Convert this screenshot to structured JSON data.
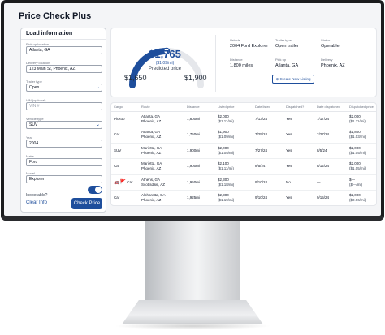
{
  "app": {
    "title": "Price Check Plus"
  },
  "form": {
    "heading": "Load information",
    "fields": [
      {
        "label": "Pick up location",
        "value": "Atlanta, GA"
      },
      {
        "label": "Delivery location",
        "value": "123 Main St, Phoenix, AZ"
      },
      {
        "label": "Trailer type",
        "value": "Open"
      },
      {
        "label": "VIN (optional)",
        "placeholder": "VIN #"
      },
      {
        "label": "Vehicle type",
        "value": "SUV"
      },
      {
        "label": "Year",
        "value": "2004"
      },
      {
        "label": "Make",
        "value": "Ford"
      },
      {
        "label": "Model",
        "value": "Explorer"
      }
    ],
    "inoperable_label": "Inoperable?",
    "inoperable_on": true,
    "clear_label": "Clear Info",
    "check_label": "Check Price"
  },
  "summary": {
    "price": "$1,765",
    "price_sub": "($1.09/mi)",
    "price_label": "Predicted price",
    "range_low": "$1,650",
    "range_high": "$1,900",
    "gauge_level": 0.5,
    "vehicle_label": "Vehicle",
    "vehicle_value": "2004 Ford Explorer",
    "trailer_label": "Trailer type",
    "trailer_value": "Open trailer",
    "status_label": "Status",
    "status_value": "Operable",
    "distance_label": "Distance",
    "distance_value": "1,800 miles",
    "pickup_label": "Pick up",
    "pickup_value": "Atlanta, GA",
    "delivery_label": "Delivery",
    "delivery_value": "Phoenix, AZ",
    "new_listing_label": "Create New Listing"
  },
  "table": {
    "headers": [
      "Cargo",
      "Route",
      "Distance",
      "Listed price",
      "Date listed",
      "Dispatched?",
      "Date dispatched",
      "Dispatched price"
    ],
    "rows": [
      [
        "Pickup",
        "Atlanta, GA",
        "Phoenix, AZ",
        "1,800mi",
        "$2,000",
        "($1.11/mi)",
        "7/13/24",
        "Yes",
        "7/17/24",
        "$2,000",
        "($1.11/mi)"
      ],
      [
        "Car",
        "Atlanta, GA",
        "Phoenix, AZ",
        "1,750mi",
        "$1,900",
        "($1.09/mi)",
        "7/25/24",
        "Yes",
        "7/27/24",
        "$1,800",
        "($1.03/mi)"
      ],
      [
        "SUV",
        "Marietta, GA",
        "Phoenix, AZ",
        "1,900mi",
        "$2,000",
        "($1.05/mi)",
        "7/27/24",
        "Yes",
        "8/5/24",
        "$2,000",
        "($1.05/mi)"
      ],
      [
        "Car",
        "Marietta, GA",
        "Phoenix, AZ",
        "1,900mi",
        "$2,100",
        "($1.11/mi)",
        "8/5/24",
        "Yes",
        "8/12/24",
        "$2,000",
        "($1.05/mi)"
      ],
      [
        "Car",
        "Athens, GA",
        "Scottsdale, AZ",
        "1,950mi",
        "$2,300",
        "($1.18/mi)",
        "9/10/24",
        "No",
        "—",
        "$—",
        "($—/mi)"
      ],
      [
        "Car",
        "Alpharetta, GA",
        "Phoenix, AZ",
        "1,925mi",
        "$2,300",
        "($1.19/mi)",
        "9/10/24",
        "Yes",
        "9/15/24",
        "$2,000",
        "($0.96/mi)"
      ]
    ]
  },
  "colors": {
    "accent": "#1e4e9c",
    "gauge_track": "#e5e7eb",
    "alert": "#dc2626"
  }
}
